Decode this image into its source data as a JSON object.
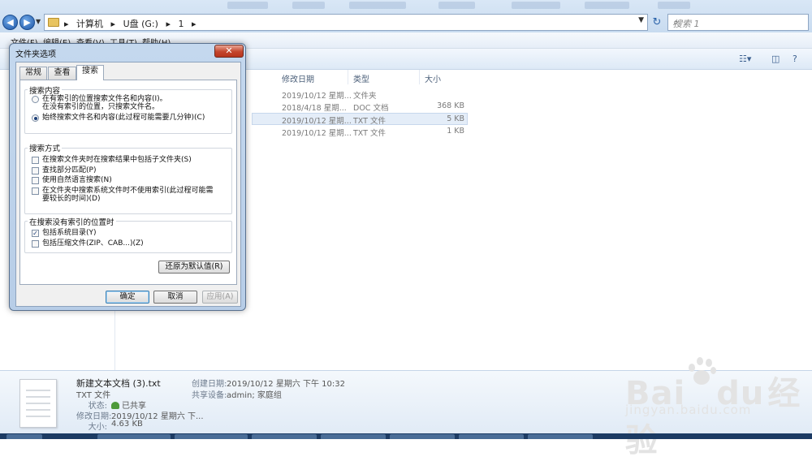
{
  "window": {
    "breadcrumb": [
      "计算机",
      "U盘 (G:)",
      "1"
    ],
    "search_placeholder": "搜索 1"
  },
  "menubar": {
    "items": [
      "文件(F)",
      "编辑(E)",
      "查看(V)",
      "工具(T)",
      "帮助(H)"
    ]
  },
  "filelist": {
    "columns": {
      "date": "修改日期",
      "type": "类型",
      "size": "大小"
    },
    "rows": [
      {
        "date": "2019/10/12 星期...",
        "type": "文件夹",
        "size": "",
        "selected": false
      },
      {
        "date": "2018/4/18 星期...",
        "type": "DOC 文档",
        "size": "368 KB",
        "selected": false
      },
      {
        "date": "2019/10/12 星期...",
        "type": "TXT 文件",
        "size": "5 KB",
        "selected": true
      },
      {
        "date": "2019/10/12 星期...",
        "type": "TXT 文件",
        "size": "1 KB",
        "selected": false
      }
    ]
  },
  "details": {
    "filename": "新建文本文档 (3).txt",
    "filetype": "TXT 文件",
    "status_label": "状态:",
    "status_value": "已共享",
    "modified_label": "修改日期:",
    "modified_value": "2019/10/12 星期六 下...",
    "size_label": "大小:",
    "size_value": "4.63 KB",
    "created_label": "创建日期:",
    "created_value": "2019/10/12 星期六 下午 10:32",
    "shared_label": "共享设备:",
    "shared_value": "admin; 家庭组"
  },
  "watermark": {
    "brand": "Bai",
    "brand_tail": "du",
    "brand_cn": "经验",
    "url": "jingyan.baidu.com"
  },
  "dialog": {
    "title": "文件夹选项",
    "close": "✕",
    "tabs": [
      "常规",
      "查看",
      "搜索"
    ],
    "active_tab": 2,
    "group1": {
      "label": "搜索内容",
      "opt1_line1": "在有索引的位置搜索文件名和内容(I)。",
      "opt1_line2": "在没有索引的位置，只搜索文件名。",
      "opt2": "始终搜索文件名和内容(此过程可能需要几分钟)(C)"
    },
    "group2": {
      "label": "搜索方式",
      "opt1": "在搜索文件夹时在搜索结果中包括子文件夹(S)",
      "opt2": "查找部分匹配(P)",
      "opt3": "使用自然语言搜索(N)",
      "opt4_line1": "在文件夹中搜索系统文件时不使用索引(此过程可能需",
      "opt4_line2": "要较长的时间)(D)"
    },
    "group3": {
      "label": "在搜索没有索引的位置时",
      "opt1": "包括系统目录(Y)",
      "opt2": "包括压缩文件(ZIP、CAB...)(Z)"
    },
    "restore_button": "还原为默认值(R)",
    "ok_button": "确定",
    "cancel_button": "取消",
    "apply_button": "应用(A)"
  }
}
